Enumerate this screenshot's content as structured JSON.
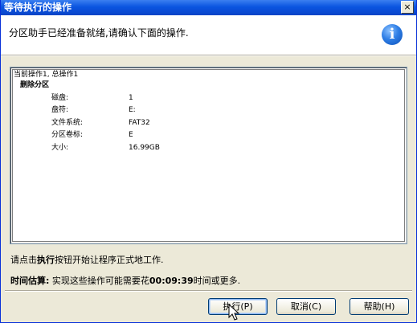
{
  "window": {
    "title": "等待执行的操作",
    "close_glyph": "×"
  },
  "header": {
    "message": "分区助手已经准备就绪,请确认下面的操作.",
    "icon": "info-icon",
    "icon_glyph": "i"
  },
  "listbox": {
    "current_line": "当前操作1, 总操作1",
    "operation_title": "删除分区",
    "fields": [
      {
        "label": "磁盘:",
        "value": "1"
      },
      {
        "label": "盘符:",
        "value": "E:"
      },
      {
        "label": "文件系统:",
        "value": "FAT32"
      },
      {
        "label": "分区卷标:",
        "value": "E"
      },
      {
        "label": "大小:",
        "value": "16.99GB"
      }
    ]
  },
  "instruction": {
    "prefix": "请点击",
    "bold": "执行",
    "suffix": "按钮开始让程序正式地工作."
  },
  "estimate": {
    "label": "时间估算:",
    "prefix": " 实现这些操作可能需要花",
    "time": "00:09:39",
    "suffix": "时间或更多."
  },
  "buttons": {
    "execute": "执行(P)",
    "cancel": "取消(C)",
    "help": "帮助(H)"
  }
}
